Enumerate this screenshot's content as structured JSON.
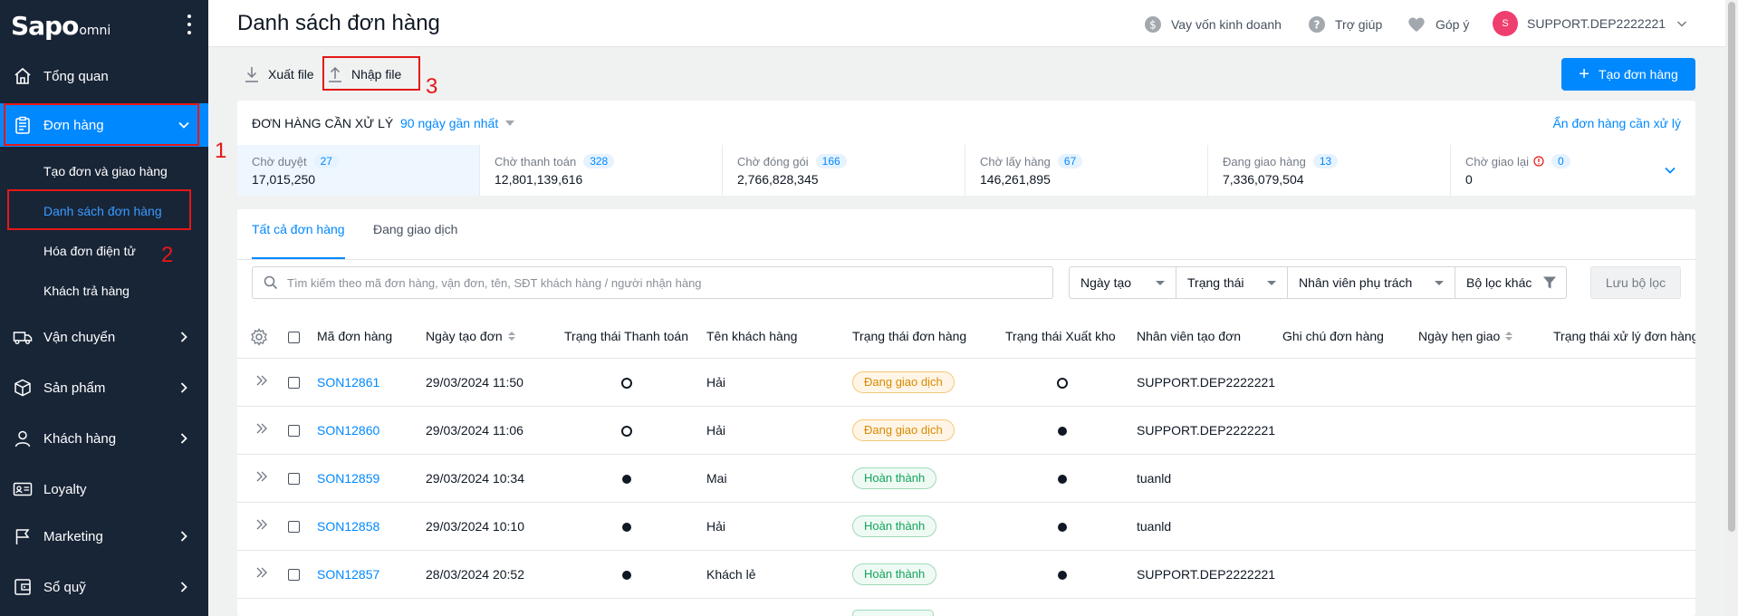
{
  "brand": {
    "logo": "Sapo",
    "logo_suffix": "omni"
  },
  "sidebar": {
    "items": [
      {
        "label": "Tổng quan",
        "icon": "home-icon"
      },
      {
        "label": "Đơn hàng",
        "icon": "clipboard-icon",
        "active": true
      },
      {
        "label": "Vận chuyển",
        "icon": "truck-icon"
      },
      {
        "label": "Sản phẩm",
        "icon": "box-icon"
      },
      {
        "label": "Khách hàng",
        "icon": "user-icon"
      },
      {
        "label": "Loyalty",
        "icon": "id-card-icon"
      },
      {
        "label": "Marketing",
        "icon": "flag-icon"
      },
      {
        "label": "Sổ quỹ",
        "icon": "wallet-icon"
      }
    ],
    "sub_items": [
      {
        "label": "Tạo đơn và giao hàng"
      },
      {
        "label": "Danh sách đơn hàng",
        "active": true
      },
      {
        "label": "Hóa đơn điện tử"
      },
      {
        "label": "Khách trả hàng"
      }
    ]
  },
  "annotations": {
    "one": "1",
    "two": "2",
    "three": "3",
    "color": "#e61717"
  },
  "header": {
    "title": "Danh sách đơn hàng",
    "loan": "Vay vốn kinh doanh",
    "help": "Trợ giúp",
    "feedback": "Góp ý",
    "avatar_letter": "S",
    "account": "SUPPORT.DEP2222221"
  },
  "toolbar": {
    "export": "Xuất file",
    "import": "Nhập file",
    "create": "Tạo đơn hàng"
  },
  "pending": {
    "title": "ĐƠN HÀNG CẦN XỬ LÝ",
    "range": "90 ngày gần nhất",
    "hide": "Ẩn đơn hàng cần xử lý",
    "stats": [
      {
        "label": "Chờ duyệt",
        "count": "27",
        "value": "17,015,250"
      },
      {
        "label": "Chờ thanh toán",
        "count": "328",
        "value": "12,801,139,616"
      },
      {
        "label": "Chờ đóng gói",
        "count": "166",
        "value": "2,766,828,345"
      },
      {
        "label": "Chờ lấy hàng",
        "count": "67",
        "value": "146,261,895"
      },
      {
        "label": "Đang giao hàng",
        "count": "13",
        "value": "7,336,079,504"
      },
      {
        "label": "Chờ giao lại",
        "count": "0",
        "value": "0"
      }
    ]
  },
  "tabs": {
    "all": "Tất cả đơn hàng",
    "trading": "Đang giao dịch"
  },
  "search": {
    "placeholder": "Tìm kiếm theo mã đơn hàng, vận đơn, tên, SĐT khách hàng / người nhận hàng"
  },
  "filters": {
    "created": "Ngày tạo",
    "status": "Trạng thái",
    "staff": "Nhân viên phụ trách",
    "other": "Bộ lọc khác",
    "save": "Lưu bộ lọc"
  },
  "table": {
    "headers": {
      "code": "Mã đơn hàng",
      "created": "Ngày tạo đơn",
      "payment": "Trạng thái Thanh toán",
      "customer": "Tên khách hàng",
      "order_status": "Trạng thái đơn hàng",
      "warehouse": "Trạng thái Xuất kho",
      "creator": "Nhân viên tạo đơn",
      "note": "Ghi chú đơn hàng",
      "appointment": "Ngày hẹn giao",
      "processing": "Trạng thái xử lý đơn hàng"
    },
    "rows": [
      {
        "code": "SON12861",
        "date": "29/03/2024 11:50",
        "paid": false,
        "customer": "Hải",
        "status": "Đang giao dịch",
        "status_kind": "warn",
        "exported": false,
        "creator": "SUPPORT.DEP2222221"
      },
      {
        "code": "SON12860",
        "date": "29/03/2024 11:06",
        "paid": false,
        "customer": "Hải",
        "status": "Đang giao dịch",
        "status_kind": "warn",
        "exported": true,
        "creator": "SUPPORT.DEP2222221"
      },
      {
        "code": "SON12859",
        "date": "29/03/2024 10:34",
        "paid": true,
        "customer": "Mai",
        "status": "Hoàn thành",
        "status_kind": "ok",
        "exported": true,
        "creator": "tuanld"
      },
      {
        "code": "SON12858",
        "date": "29/03/2024 10:10",
        "paid": true,
        "customer": "Hải",
        "status": "Hoàn thành",
        "status_kind": "ok",
        "exported": true,
        "creator": "tuanld"
      },
      {
        "code": "SON12857",
        "date": "28/03/2024 20:52",
        "paid": true,
        "customer": "Khách lẻ",
        "status": "Hoàn thành",
        "status_kind": "ok",
        "exported": true,
        "creator": "SUPPORT.DEP2222221"
      }
    ]
  }
}
